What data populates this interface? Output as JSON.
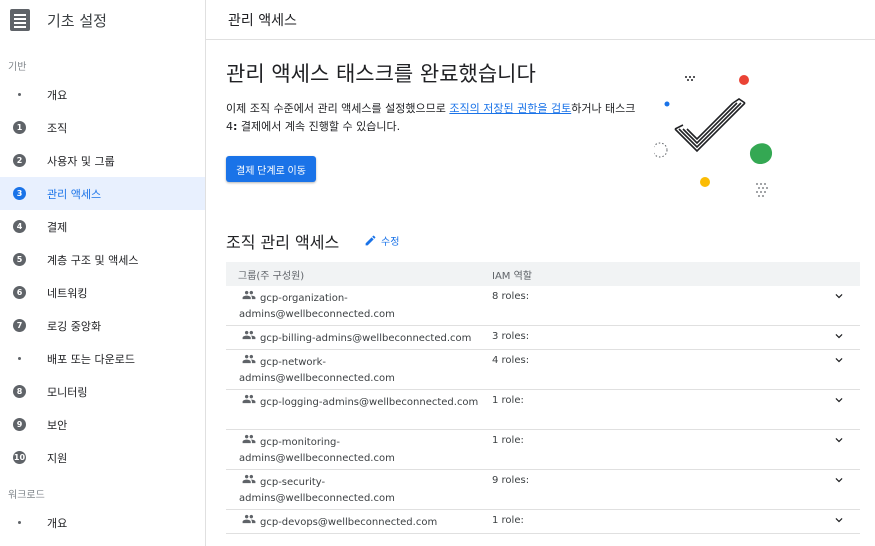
{
  "sidebar": {
    "title": "기초 설정",
    "sections": [
      {
        "title": "기반",
        "items": [
          {
            "marker": "",
            "label": "개요"
          },
          {
            "marker": "1",
            "label": "조직"
          },
          {
            "marker": "2",
            "label": "사용자 및 그룹"
          },
          {
            "marker": "3",
            "label": "관리 액세스",
            "active": true
          },
          {
            "marker": "4",
            "label": "결제"
          },
          {
            "marker": "5",
            "label": "계층 구조 및 액세스"
          },
          {
            "marker": "6",
            "label": "네트워킹"
          },
          {
            "marker": "7",
            "label": "로깅 중앙화"
          },
          {
            "marker": "",
            "label": "배포 또는 다운로드"
          },
          {
            "marker": "8",
            "label": "모니터링"
          },
          {
            "marker": "9",
            "label": "보안"
          },
          {
            "marker": "10",
            "label": "지원"
          }
        ]
      },
      {
        "title": "워크로드",
        "items": [
          {
            "marker": "",
            "label": "개요"
          }
        ]
      }
    ]
  },
  "header": {
    "title": "관리 액세스"
  },
  "main": {
    "heading": "관리 액세스 태스크를 완료했습니다",
    "desc_1": "이제 조직 수준에서 관리 액세스를 설정했으므로 ",
    "desc_link": "조직의 저장된 권한을 검토",
    "desc_2": "하거나 태스크 4",
    "desc_bold_colon": ":",
    "desc_3": " 결제에서 계속 진행할 수 있습니다.",
    "primary_button": "결제 단계로 이동",
    "section_heading": "조직 관리 액세스",
    "edit_label": "수정"
  },
  "table": {
    "columns": [
      "그룹(주 구성원)",
      "IAM 역할"
    ],
    "rows": [
      {
        "group": "gcp-organization-admins@wellbeconnected.com",
        "role": "8 roles:"
      },
      {
        "group": "gcp-billing-admins@wellbeconnected.com",
        "role": "3 roles:"
      },
      {
        "group": "gcp-network-admins@wellbeconnected.com",
        "role": "4 roles:"
      },
      {
        "group": "gcp-logging-admins@wellbeconnected.com",
        "role": "1 role:"
      },
      {
        "group": "gcp-monitoring-admins@wellbeconnected.com",
        "role": "1 role:"
      },
      {
        "group": "gcp-security-admins@wellbeconnected.com",
        "role": "9 roles:"
      },
      {
        "group": "gcp-devops@wellbeconnected.com",
        "role": "1 role:"
      }
    ]
  },
  "colors": {
    "accent": "#1a73e8",
    "active_bg": "#e8f0fe",
    "red": "#ea4335",
    "green": "#34a853",
    "yellow": "#fbbc04"
  },
  "icons": [
    "setup-checklist-icon",
    "edit-pencil-icon",
    "group-people-icon",
    "chevron-down-icon"
  ]
}
